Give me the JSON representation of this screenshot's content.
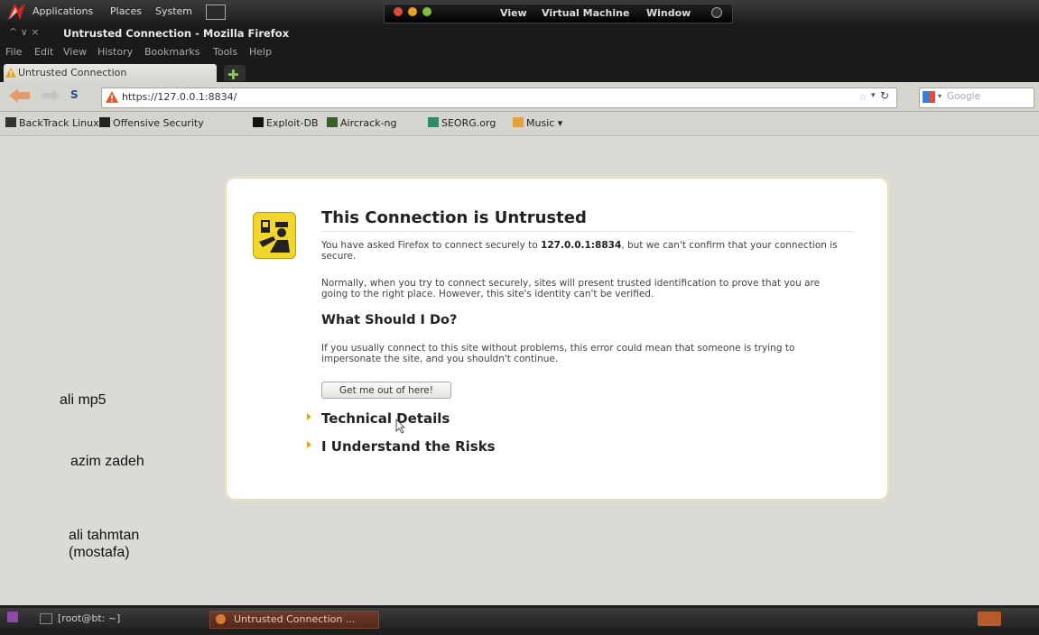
{
  "gnome_panel": {
    "menus": [
      "Applications",
      "Places",
      "System"
    ],
    "vm_menu": [
      "View",
      "Virtual Machine",
      "Window"
    ]
  },
  "window": {
    "title": "Untrusted Connection - Mozilla Firefox",
    "controls": "^ ∨ ×"
  },
  "menubar": [
    "File",
    "Edit",
    "View",
    "History",
    "Bookmarks",
    "Tools",
    "Help"
  ],
  "tab": {
    "label": "Untrusted Connection"
  },
  "navbar": {
    "url": "https://127.0.0.1:8834/",
    "search_placeholder": "Google"
  },
  "bookmarks": [
    "BackTrack Linux",
    "Offensive Security",
    "Exploit-DB",
    "Aircrack-ng",
    "SEORG.org",
    "Music ▾"
  ],
  "error_page": {
    "title": "This Connection is Untrusted",
    "p1_before": "You have asked Firefox to connect securely to ",
    "p1_host": "127.0.0.1:8834",
    "p1_after": ", but we can't confirm that your connection is secure.",
    "p2": "Normally, when you try to connect securely, sites will present trusted identification to prove that you are going to the right place. However, this site's identity can't be verified.",
    "what_title": "What Should I Do?",
    "p3": "If you usually connect to this site without problems, this error could mean that someone is trying to impersonate the site, and you shouldn't continue.",
    "button": "Get me out of here!",
    "expander1": "Technical Details",
    "expander2": "I Understand the Risks"
  },
  "overlay_notes": {
    "note1": "ali mp5",
    "note2": "azim zadeh",
    "note3_line1": "ali tahmtan",
    "note3_line2": "(mostafa)"
  },
  "taskbar": {
    "terminal": "[root@bt: ~]",
    "firefox": "Untrusted Connection ..."
  }
}
